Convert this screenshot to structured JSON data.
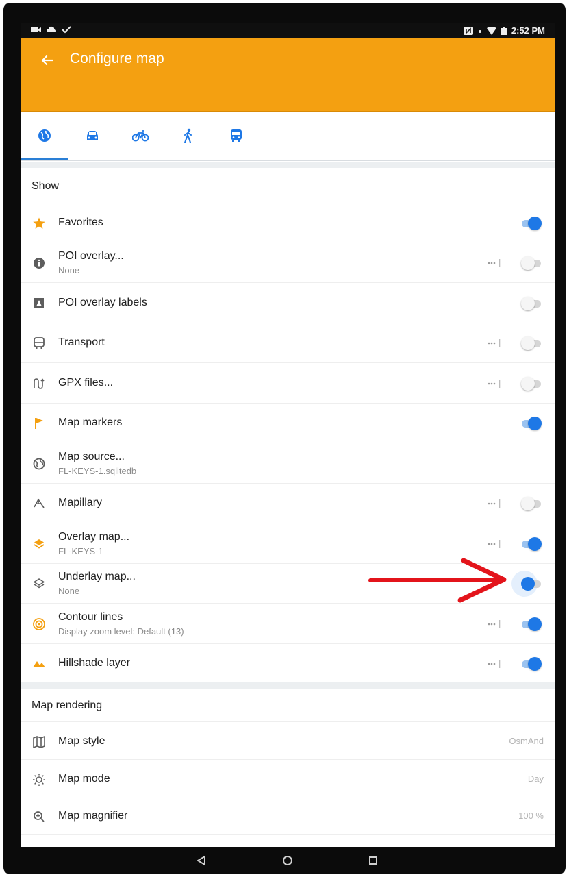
{
  "status_bar": {
    "time": "2:52 PM"
  },
  "app_bar": {
    "title": "Configure map"
  },
  "profile_tabs": [
    "browse-map",
    "car",
    "bicycle",
    "pedestrian",
    "public-transport"
  ],
  "sections": {
    "show": {
      "title": "Show"
    },
    "rendering": {
      "title": "Map rendering"
    }
  },
  "show_items": [
    {
      "label": "Favorites",
      "sub": "",
      "icon": "star-icon",
      "toggle": "on",
      "more": false
    },
    {
      "label": "POI overlay...",
      "sub": "None",
      "icon": "info-icon",
      "toggle": "off",
      "more": true
    },
    {
      "label": "POI overlay labels",
      "sub": "",
      "icon": "poi-labels-icon",
      "toggle": "off",
      "more": false
    },
    {
      "label": "Transport",
      "sub": "",
      "icon": "bus-icon",
      "toggle": "off",
      "more": true
    },
    {
      "label": "GPX files...",
      "sub": "",
      "icon": "gpx-track-icon",
      "toggle": "off",
      "more": true
    },
    {
      "label": "Map markers",
      "sub": "",
      "icon": "flag-icon",
      "toggle": "on",
      "more": false
    },
    {
      "label": "Map source...",
      "sub": "FL-KEYS-1.sqlitedb",
      "icon": "globe-icon",
      "toggle": "none",
      "more": false
    },
    {
      "label": "Mapillary",
      "sub": "",
      "icon": "mapillary-icon",
      "toggle": "off",
      "more": true
    },
    {
      "label": "Overlay map...",
      "sub": "FL-KEYS-1",
      "icon": "overlay-layers-icon",
      "toggle": "on",
      "more": true
    },
    {
      "label": "Underlay map...",
      "sub": "None",
      "icon": "underlay-layers-icon",
      "toggle": "focus",
      "more": false
    },
    {
      "label": "Contour lines",
      "sub": "Display zoom level: Default (13)",
      "icon": "contour-icon",
      "toggle": "on",
      "more": true
    },
    {
      "label": "Hillshade layer",
      "sub": "",
      "icon": "hillshade-icon",
      "toggle": "on",
      "more": true
    }
  ],
  "rendering_items": [
    {
      "label": "Map style",
      "value": "OsmAnd",
      "icon": "map-icon"
    },
    {
      "label": "Map mode",
      "value": "Day",
      "icon": "sun-icon"
    },
    {
      "label": "Map magnifier",
      "value": "100 %",
      "icon": "magnifier-icon"
    }
  ],
  "colors": {
    "accent": "#f4a011",
    "toggle_on": "#1e78e6",
    "annotation_arrow": "#e3141b"
  }
}
